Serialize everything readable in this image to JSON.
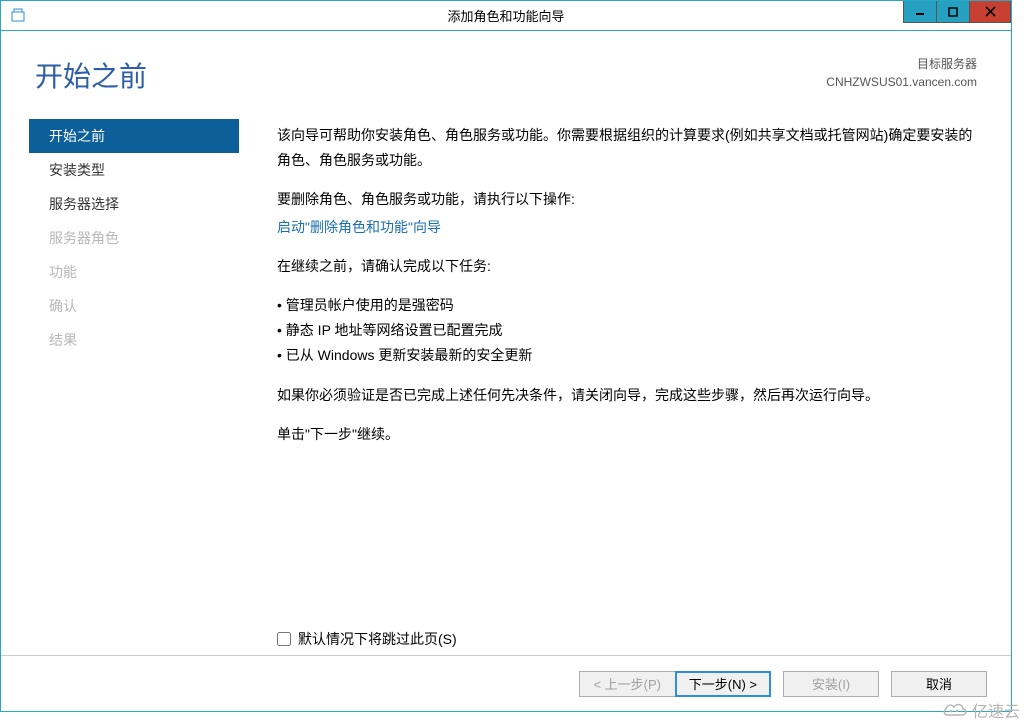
{
  "window": {
    "title": "添加角色和功能向导"
  },
  "header": {
    "page_title": "开始之前",
    "target_label": "目标服务器",
    "target_server": "CNHZWSUS01.vancen.com"
  },
  "sidebar": {
    "items": [
      {
        "label": "开始之前",
        "state": "active"
      },
      {
        "label": "安装类型",
        "state": ""
      },
      {
        "label": "服务器选择",
        "state": ""
      },
      {
        "label": "服务器角色",
        "state": "disabled"
      },
      {
        "label": "功能",
        "state": "disabled"
      },
      {
        "label": "确认",
        "state": "disabled"
      },
      {
        "label": "结果",
        "state": "disabled"
      }
    ]
  },
  "content": {
    "intro": "该向导可帮助你安装角色、角色服务或功能。你需要根据组织的计算要求(例如共享文档或托管网站)确定要安装的角色、角色服务或功能。",
    "remove_line": "要删除角色、角色服务或功能，请执行以下操作:",
    "remove_link": "启动\"删除角色和功能\"向导",
    "confirm_line": "在继续之前，请确认完成以下任务:",
    "bullets": [
      "管理员帐户使用的是强密码",
      "静态 IP 地址等网络设置已配置完成",
      "已从 Windows 更新安装最新的安全更新"
    ],
    "verify_line": "如果你必须验证是否已完成上述任何先决条件，请关闭向导，完成这些步骤，然后再次运行向导。",
    "continue_line": "单击\"下一步\"继续。",
    "skip_checkbox": "默认情况下将跳过此页(S)"
  },
  "buttons": {
    "prev": "< 上一步(P)",
    "next": "下一步(N) >",
    "install": "安装(I)",
    "cancel": "取消"
  },
  "watermark": {
    "text": "亿速云"
  }
}
